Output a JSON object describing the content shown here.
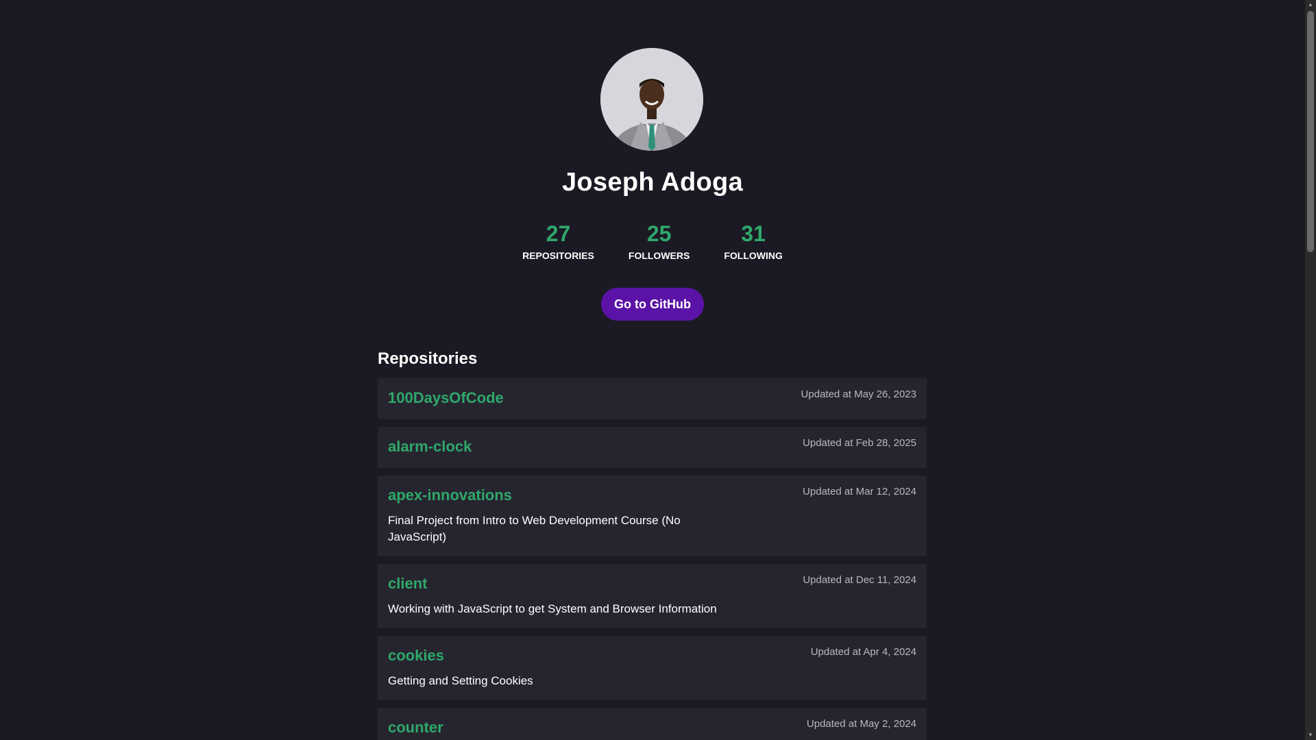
{
  "profile": {
    "name": "Joseph Adoga",
    "stats": [
      {
        "value": "27",
        "label": "REPOSITORIES"
      },
      {
        "value": "25",
        "label": "FOLLOWERS"
      },
      {
        "value": "31",
        "label": "FOLLOWING"
      }
    ],
    "button_label": "Go to GitHub"
  },
  "repositories": {
    "heading": "Repositories",
    "items": [
      {
        "name": "100DaysOfCode",
        "updated": "Updated at May 26, 2023",
        "description": ""
      },
      {
        "name": "alarm-clock",
        "updated": "Updated at Feb 28, 2025",
        "description": ""
      },
      {
        "name": "apex-innovations",
        "updated": "Updated at Mar 12, 2024",
        "description": "Final Project from Intro to Web Development Course (No JavaScript)"
      },
      {
        "name": "client",
        "updated": "Updated at Dec 11, 2024",
        "description": "Working with JavaScript to get System and Browser Information"
      },
      {
        "name": "cookies",
        "updated": "Updated at Apr 4, 2024",
        "description": "Getting and Setting Cookies"
      },
      {
        "name": "counter",
        "updated": "Updated at May 2, 2024",
        "description": ""
      }
    ]
  },
  "colors": {
    "background": "#1b1a24",
    "card": "#26252f",
    "accent_green": "#2fa86b",
    "button_purple": "#5b12a6"
  }
}
